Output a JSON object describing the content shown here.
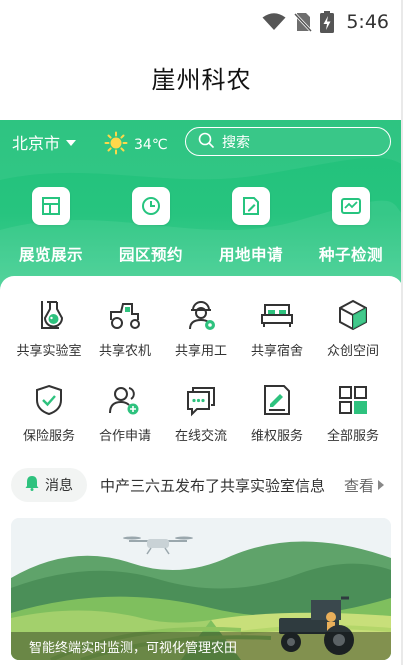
{
  "status_bar": {
    "time": "5:46",
    "icons": [
      "wifi-icon",
      "no-sim-icon",
      "battery-charging-icon"
    ]
  },
  "app": {
    "title": "崖州科农"
  },
  "header": {
    "location": "北京市",
    "weather": {
      "icon": "sun-icon",
      "temperature": "34℃"
    },
    "search": {
      "placeholder": "搜索",
      "icon": "search-icon"
    }
  },
  "quick_links": [
    {
      "label": "展览展示",
      "icon": "grid-icon"
    },
    {
      "label": "园区预约",
      "icon": "clock-icon"
    },
    {
      "label": "用地申请",
      "icon": "edit-document-icon"
    },
    {
      "label": "种子检测",
      "icon": "chart-screen-icon"
    }
  ],
  "services": [
    {
      "label": "共享实验室",
      "icon": "flask-icon"
    },
    {
      "label": "共享农机",
      "icon": "tractor-icon"
    },
    {
      "label": "共享用工",
      "icon": "worker-icon"
    },
    {
      "label": "共享宿舍",
      "icon": "bed-icon"
    },
    {
      "label": "众创空间",
      "icon": "cube-icon"
    },
    {
      "label": "保险服务",
      "icon": "shield-check-icon"
    },
    {
      "label": "合作申请",
      "icon": "people-add-icon"
    },
    {
      "label": "在线交流",
      "icon": "chat-icon"
    },
    {
      "label": "维权服务",
      "icon": "document-pen-icon"
    },
    {
      "label": "全部服务",
      "icon": "apps-grid-icon"
    }
  ],
  "notice": {
    "tag": "消息",
    "icon": "bell-icon",
    "text": "中产三六五发布了共享实验室信息",
    "more": "查看"
  },
  "banner": {
    "caption": "智能终端实时监测，可视化管理农田"
  },
  "colors": {
    "primary": "#27c47f",
    "icon_dark": "#333333",
    "icon_accent": "#2ec27e"
  }
}
